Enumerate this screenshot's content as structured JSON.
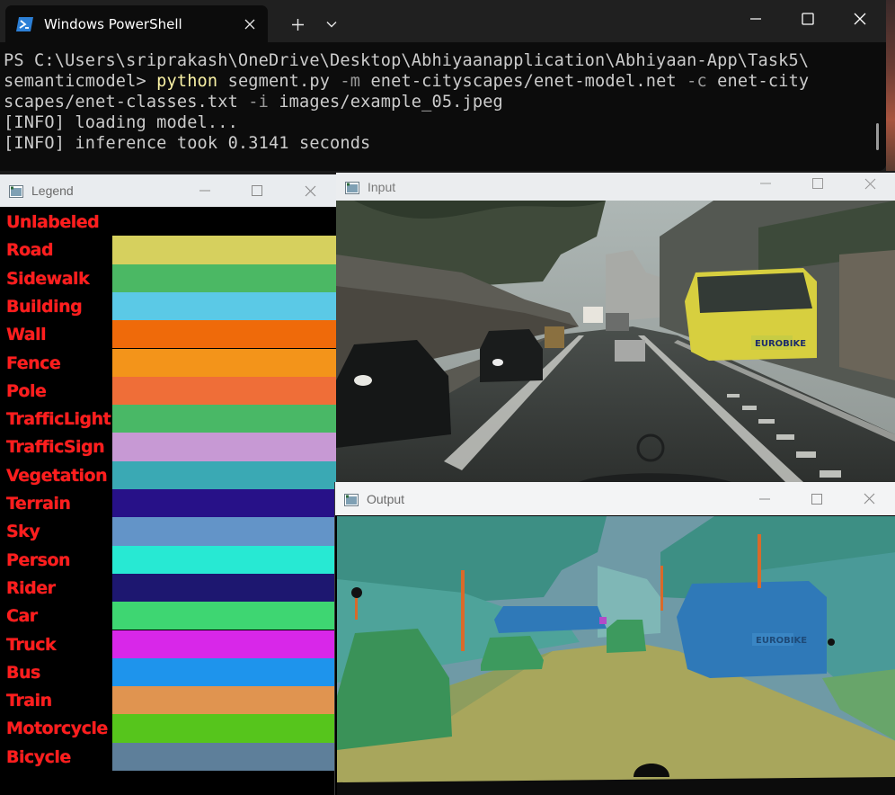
{
  "terminal": {
    "tab_title": "Windows PowerShell",
    "lines": [
      {
        "prompt": "PS C:\\Users\\sriprakash\\OneDrive\\Desktop\\Abhiyaanapplication\\Abhiyaan-App\\Task5\\"
      },
      {
        "prompt2": "semanticmodel> ",
        "cmd": "python",
        "rest1": " segment.py ",
        "flag1": "-m",
        "rest2": " enet-cityscapes/enet-model.net ",
        "flag2": "-c",
        "rest3": " enet-city"
      },
      {
        "rest4": "scapes/enet-classes.txt ",
        "flag3": "-i",
        "rest5": " images/example_05.jpeg"
      },
      {
        "text": "[INFO] loading model..."
      },
      {
        "text": "[INFO] inference took 0.3141 seconds"
      }
    ]
  },
  "windows": {
    "legend_title": "Legend",
    "input_title": "Input",
    "output_title": "Output"
  },
  "legend": [
    {
      "label": "Unlabeled",
      "color": "#000000"
    },
    {
      "label": "Road",
      "color": "#d6d05e"
    },
    {
      "label": "Sidewalk",
      "color": "#4bb864"
    },
    {
      "label": "Building",
      "color": "#5bc9e6"
    },
    {
      "label": "Wall",
      "color": "#ef6a0a"
    },
    {
      "label": "Fence",
      "color": "#f3941a"
    },
    {
      "label": "Pole",
      "color": "#ef6e38"
    },
    {
      "label": "TrafficLight",
      "color": "#49b866"
    },
    {
      "label": "TrafficSign",
      "color": "#c799d4"
    },
    {
      "label": "Vegetation",
      "color": "#3aa9b4"
    },
    {
      "label": "Terrain",
      "color": "#271188"
    },
    {
      "label": "Sky",
      "color": "#6394c8"
    },
    {
      "label": "Person",
      "color": "#27e9d3"
    },
    {
      "label": "Rider",
      "color": "#1d1770"
    },
    {
      "label": "Car",
      "color": "#3ed672"
    },
    {
      "label": "Truck",
      "color": "#d827e9"
    },
    {
      "label": "Bus",
      "color": "#1e94ec"
    },
    {
      "label": "Train",
      "color": "#e09450"
    },
    {
      "label": "Motorcycle",
      "color": "#56c51c"
    },
    {
      "label": "Bicycle",
      "color": "#5e7f9a"
    }
  ],
  "input_scene": {
    "bus_sign": "EUROBIKE"
  },
  "output_scene": {
    "bus_sign": "EUROBIKE"
  }
}
